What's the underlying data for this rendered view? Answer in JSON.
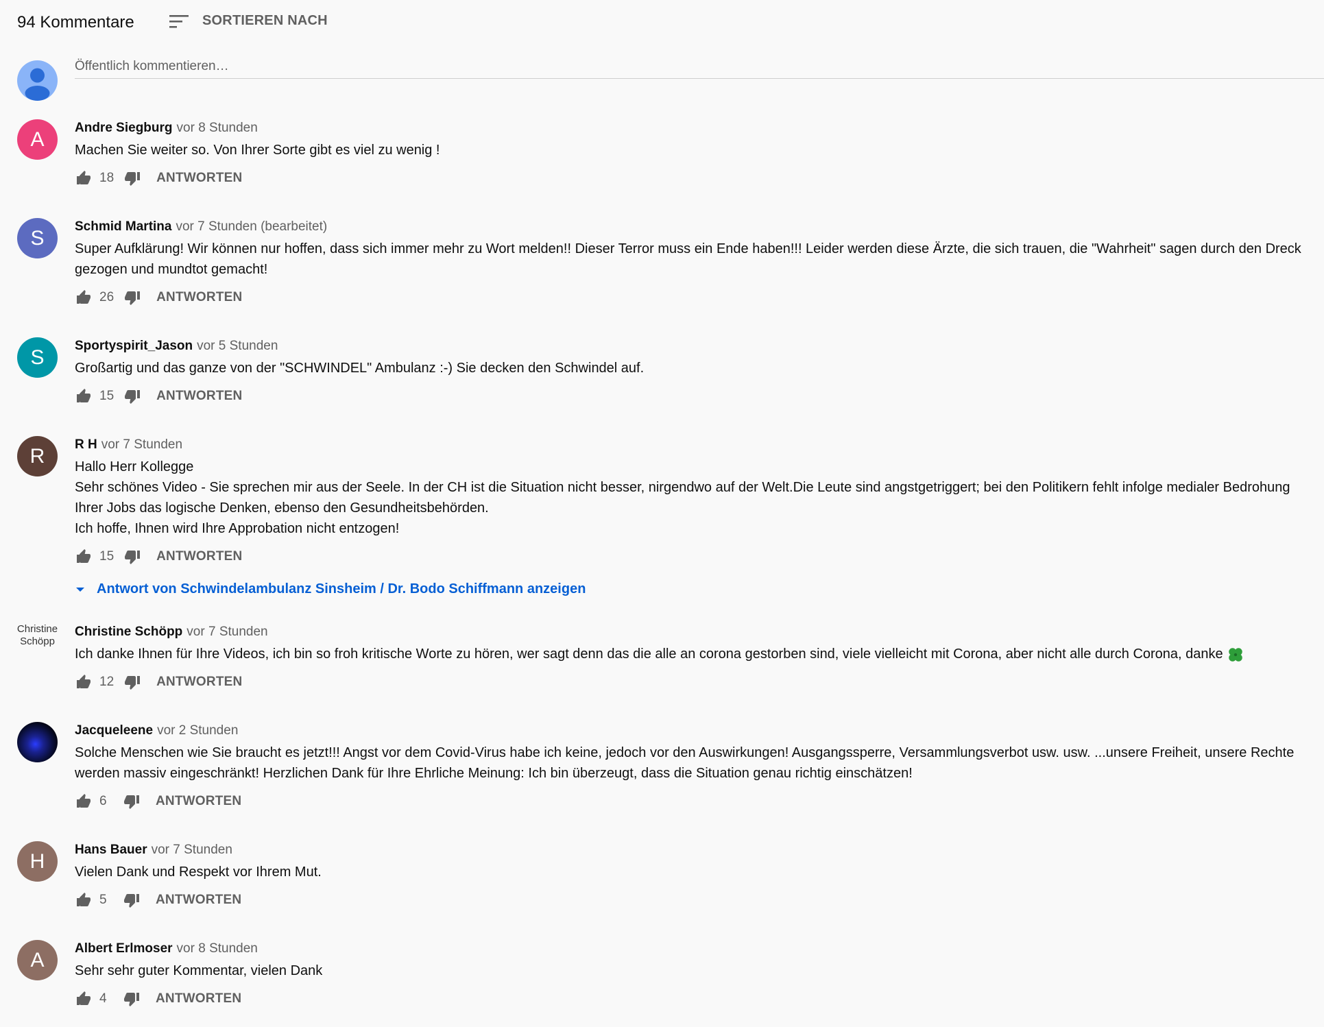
{
  "header": {
    "comment_count": "94 Kommentare",
    "sort_label": "SORTIEREN NACH"
  },
  "add_comment": {
    "placeholder": "Öffentlich kommentieren…"
  },
  "reply_label": "ANTWORTEN",
  "comments": [
    {
      "author": "Andre Siegburg",
      "time": "vor 8 Stunden",
      "avatar_letter": "A",
      "avatar_color": "#ec407a",
      "text": "Machen Sie weiter so. Von Ihrer Sorte gibt es viel zu wenig !",
      "likes": "18"
    },
    {
      "author": "Schmid Martina",
      "time": "vor 7 Stunden (bearbeitet)",
      "avatar_letter": "S",
      "avatar_color": "#5c6bc0",
      "text": "Super Aufklärung! Wir können nur hoffen, dass sich immer mehr zu Wort melden!! Dieser Terror muss ein Ende haben!!! Leider werden diese Ärzte, die sich trauen, die \"Wahrheit\" sagen durch den Dreck gezogen und mundtot gemacht!",
      "likes": "26"
    },
    {
      "author": "Sportyspirit_Jason",
      "time": "vor 5 Stunden",
      "avatar_letter": "S",
      "avatar_color": "#0097a7",
      "text": "Großartig und das ganze von der \"SCHWINDEL\" Ambulanz :-) Sie decken den Schwindel auf.",
      "likes": "15"
    },
    {
      "author": "R H",
      "time": "vor 7 Stunden",
      "avatar_letter": "R",
      "avatar_color": "#5d4037",
      "text": "Hallo Herr Kollegge\nSehr schönes Video - Sie sprechen mir aus der Seele. In der CH ist die Situation nicht besser, nirgendwo auf der Welt.Die Leute sind angstgetriggert; bei den Politikern fehlt infolge medialer Bedrohung Ihrer Jobs das logische Denken, ebenso den Gesundheitsbehörden.\nIch hoffe, Ihnen wird Ihre Approbation nicht entzogen!",
      "likes": "15",
      "show_replies": "Antwort von Schwindelambulanz Sinsheim / Dr. Bodo Schiffmann anzeigen"
    },
    {
      "author": "Christine Schöpp",
      "time": "vor 7 Stunden",
      "avatar_letter": "",
      "avatar_alt": "Christine Schöpp",
      "avatar_type": "broken",
      "text": "Ich danke Ihnen für Ihre Videos, ich bin so froh kritische Worte zu hören, wer sagt denn das die alle an corona gestorben sind, viele vielleicht mit Corona, aber nicht alle durch Corona, danke ",
      "emoji": "four-leaf-clover-icon",
      "likes": "12"
    },
    {
      "author": "Jacqueleene",
      "time": "vor 2 Stunden",
      "avatar_letter": "",
      "avatar_type": "photo",
      "text": "Solche Menschen wie Sie braucht es jetzt!!! Angst vor dem Covid-Virus habe ich keine, jedoch vor den Auswirkungen! Ausgangssperre, Versammlungsverbot usw. usw. ...unsere Freiheit, unsere Rechte werden massiv eingeschränkt! Herzlichen Dank für Ihre Ehrliche Meinung: Ich bin überzeugt, dass die Situation genau richtig einschätzen!",
      "likes": "6"
    },
    {
      "author": "Hans Bauer",
      "time": "vor 7 Stunden",
      "avatar_letter": "H",
      "avatar_color": "#8d6e63",
      "text": "Vielen Dank und Respekt vor Ihrem Mut.",
      "likes": "5"
    },
    {
      "author": "Albert Erlmoser",
      "time": "vor 8 Stunden",
      "avatar_letter": "A",
      "avatar_color": "#8d6e63",
      "text": "Sehr sehr guter Kommentar, vielen Dank",
      "likes": "4"
    }
  ]
}
